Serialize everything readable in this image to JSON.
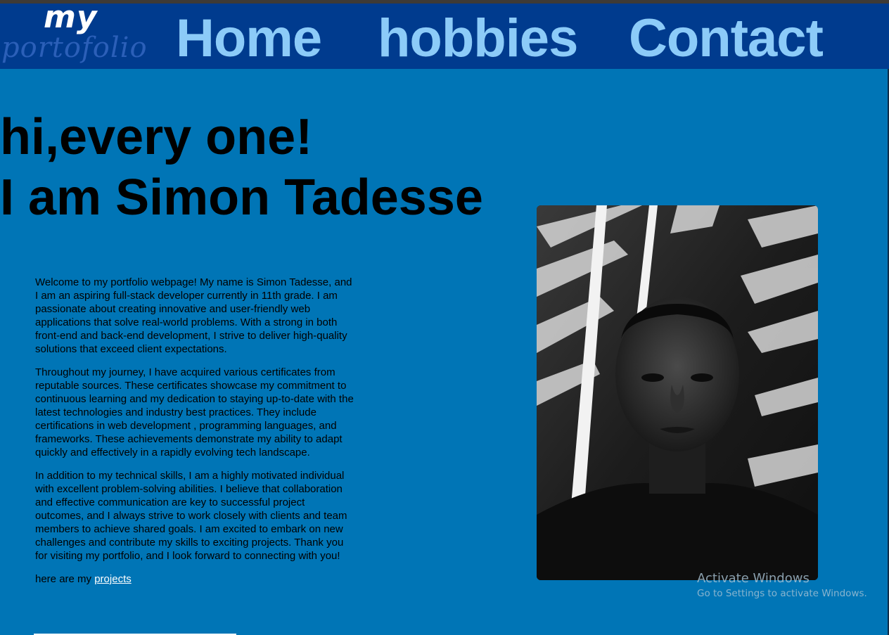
{
  "logo": {
    "line1": "my",
    "line2": "portofolio"
  },
  "nav": {
    "home": "Home",
    "hobbies": "hobbies",
    "contact": "Contact"
  },
  "hero": {
    "line1": "hi,every one!",
    "line2": "I am Simon Tadesse"
  },
  "about": {
    "p1": "Welcome to my portfolio webpage! My name is Simon Tadesse, and I am an aspiring full-stack developer currently in 11th grade. I am passionate about creating innovative and user-friendly web applications that solve real-world problems. With a strong in both front-end and back-end development, I strive to deliver high-quality solutions that exceed client expectations.",
    "p2": "Throughout my journey, I have acquired various certificates from reputable sources. These certificates showcase my commitment to continuous learning and my dedication to staying up-to-date with the latest technologies and industry best practices. They include certifications in web development , programming languages, and frameworks. These achievements demonstrate my ability to adapt quickly and effectively in a rapidly evolving tech landscape.",
    "p3": "In addition to my technical skills, I am a highly motivated individual with excellent problem-solving abilities. I believe that collaboration and effective communication are key to successful project outcomes, and I always strive to work closely with clients and team members to achieve shared goals. I am excited to embark on new challenges and contribute my skills to exciting projects. Thank you for visiting my portfolio, and I look forward to connecting with you!",
    "projects_prefix": "here are my",
    "projects_link": "projects"
  },
  "watermark": {
    "title": "Activate Windows",
    "subtitle": "Go to Settings to activate Windows."
  },
  "colors": {
    "page_bg": "#0075b6",
    "nav_bg": "#003b8e",
    "nav_link": "#8ccbf8",
    "logo_sub": "#2b5fb8"
  }
}
